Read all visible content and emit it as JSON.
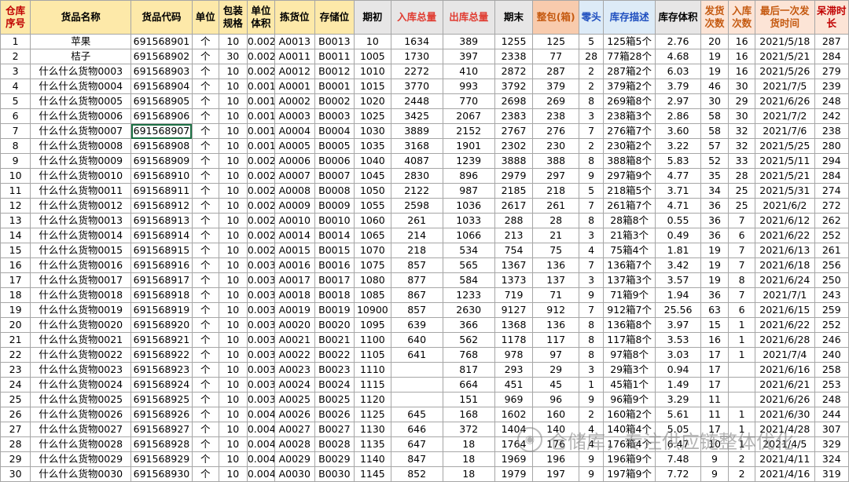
{
  "headers": {
    "seq": "仓库序号",
    "name": "货品名称",
    "code": "货品代码",
    "unit": "单位",
    "pack": "包装规格",
    "unitvol": "单位体积",
    "pick": "拣货位",
    "store": "存储位",
    "begin": "期初",
    "in": "入库总量",
    "out": "出库总量",
    "end": "期末",
    "whole": "整包(箱)",
    "loose": "零头",
    "desc": "库存描述",
    "vol": "库存体积",
    "dispatch": "发货次数",
    "inbound": "入库次数",
    "last": "最后一次发货时间",
    "idle": "呆滞时长"
  },
  "header_colors": {
    "yellow": "#fde9a9",
    "gray": "#e7e6e6",
    "pink": "#f8cbad",
    "blue": "#ddebf7",
    "tan": "#fce4d6"
  },
  "rows": [
    [
      "1",
      "苹果",
      "691568901",
      "个",
      "10",
      "0.002",
      "A0013",
      "B0013",
      "10",
      "1634",
      "389",
      "1255",
      "125",
      "5",
      "125箱5个",
      "2.76",
      "20",
      "16",
      "2021/5/18",
      "287"
    ],
    [
      "2",
      "桔子",
      "691568902",
      "个",
      "30",
      "0.002",
      "A0011",
      "B0011",
      "1005",
      "1730",
      "397",
      "2338",
      "77",
      "28",
      "77箱28个",
      "4.68",
      "19",
      "16",
      "2021/5/21",
      "284"
    ],
    [
      "3",
      "什么什么货物0003",
      "691568903",
      "个",
      "10",
      "0.002",
      "A0012",
      "B0012",
      "1010",
      "2272",
      "410",
      "2872",
      "287",
      "2",
      "287箱2个",
      "6.03",
      "19",
      "16",
      "2021/5/26",
      "279"
    ],
    [
      "4",
      "什么什么货物0004",
      "691568904",
      "个",
      "10",
      "0.001",
      "A0001",
      "B0001",
      "1015",
      "3770",
      "993",
      "3792",
      "379",
      "2",
      "379箱2个",
      "3.79",
      "46",
      "30",
      "2021/7/5",
      "239"
    ],
    [
      "5",
      "什么什么货物0005",
      "691568905",
      "个",
      "10",
      "0.001",
      "A0002",
      "B0002",
      "1020",
      "2448",
      "770",
      "2698",
      "269",
      "8",
      "269箱8个",
      "2.97",
      "30",
      "29",
      "2021/6/26",
      "248"
    ],
    [
      "6",
      "什么什么货物0006",
      "691568906",
      "个",
      "10",
      "0.001",
      "A0003",
      "B0003",
      "1025",
      "3425",
      "2067",
      "2383",
      "238",
      "3",
      "238箱3个",
      "2.86",
      "58",
      "30",
      "2021/7/2",
      "242"
    ],
    [
      "7",
      "什么什么货物0007",
      "691568907",
      "个",
      "10",
      "0.001",
      "A0004",
      "B0004",
      "1030",
      "3889",
      "2152",
      "2767",
      "276",
      "7",
      "276箱7个",
      "3.60",
      "58",
      "32",
      "2021/7/6",
      "238"
    ],
    [
      "8",
      "什么什么货物0008",
      "691568908",
      "个",
      "10",
      "0.001",
      "A0005",
      "B0005",
      "1035",
      "3168",
      "1901",
      "2302",
      "230",
      "2",
      "230箱2个",
      "3.22",
      "57",
      "32",
      "2021/5/25",
      "280"
    ],
    [
      "9",
      "什么什么货物0009",
      "691568909",
      "个",
      "10",
      "0.002",
      "A0006",
      "B0006",
      "1040",
      "4087",
      "1239",
      "3888",
      "388",
      "8",
      "388箱8个",
      "5.83",
      "52",
      "33",
      "2021/5/11",
      "294"
    ],
    [
      "10",
      "什么什么货物0010",
      "691568910",
      "个",
      "10",
      "0.002",
      "A0007",
      "B0007",
      "1045",
      "2830",
      "896",
      "2979",
      "297",
      "9",
      "297箱9个",
      "4.77",
      "35",
      "28",
      "2021/5/21",
      "284"
    ],
    [
      "11",
      "什么什么货物0011",
      "691568911",
      "个",
      "10",
      "0.002",
      "A0008",
      "B0008",
      "1050",
      "2122",
      "987",
      "2185",
      "218",
      "5",
      "218箱5个",
      "3.71",
      "34",
      "25",
      "2021/5/31",
      "274"
    ],
    [
      "12",
      "什么什么货物0012",
      "691568912",
      "个",
      "10",
      "0.002",
      "A0009",
      "B0009",
      "1055",
      "2598",
      "1036",
      "2617",
      "261",
      "7",
      "261箱7个",
      "4.71",
      "36",
      "25",
      "2021/6/2",
      "272"
    ],
    [
      "13",
      "什么什么货物0013",
      "691568913",
      "个",
      "10",
      "0.002",
      "A0010",
      "B0010",
      "1060",
      "261",
      "1033",
      "288",
      "28",
      "8",
      "28箱8个",
      "0.55",
      "36",
      "7",
      "2021/6/12",
      "262"
    ],
    [
      "14",
      "什么什么货物0014",
      "691568914",
      "个",
      "10",
      "0.002",
      "A0014",
      "B0014",
      "1065",
      "214",
      "1066",
      "213",
      "21",
      "3",
      "21箱3个",
      "0.49",
      "36",
      "6",
      "2021/6/22",
      "252"
    ],
    [
      "15",
      "什么什么货物0015",
      "691568915",
      "个",
      "10",
      "0.002",
      "A0015",
      "B0015",
      "1070",
      "218",
      "534",
      "754",
      "75",
      "4",
      "75箱4个",
      "1.81",
      "19",
      "7",
      "2021/6/13",
      "261"
    ],
    [
      "16",
      "什么什么货物0016",
      "691568916",
      "个",
      "10",
      "0.003",
      "A0016",
      "B0016",
      "1075",
      "857",
      "565",
      "1367",
      "136",
      "7",
      "136箱7个",
      "3.42",
      "19",
      "7",
      "2021/6/18",
      "256"
    ],
    [
      "17",
      "什么什么货物0017",
      "691568917",
      "个",
      "10",
      "0.003",
      "A0017",
      "B0017",
      "1080",
      "877",
      "584",
      "1373",
      "137",
      "3",
      "137箱3个",
      "3.57",
      "19",
      "8",
      "2021/6/24",
      "250"
    ],
    [
      "18",
      "什么什么货物0018",
      "691568918",
      "个",
      "10",
      "0.003",
      "A0018",
      "B0018",
      "1085",
      "867",
      "1233",
      "719",
      "71",
      "9",
      "71箱9个",
      "1.94",
      "36",
      "7",
      "2021/7/1",
      "243"
    ],
    [
      "19",
      "什么什么货物0019",
      "691568919",
      "个",
      "10",
      "0.003",
      "A0019",
      "B0019",
      "10900",
      "857",
      "2630",
      "9127",
      "912",
      "7",
      "912箱7个",
      "25.56",
      "63",
      "6",
      "2021/6/15",
      "259"
    ],
    [
      "20",
      "什么什么货物0020",
      "691568920",
      "个",
      "10",
      "0.003",
      "A0020",
      "B0020",
      "1095",
      "639",
      "366",
      "1368",
      "136",
      "8",
      "136箱8个",
      "3.97",
      "15",
      "1",
      "2021/6/22",
      "252"
    ],
    [
      "21",
      "什么什么货物0021",
      "691568921",
      "个",
      "10",
      "0.003",
      "A0021",
      "B0021",
      "1100",
      "640",
      "562",
      "1178",
      "117",
      "8",
      "117箱8个",
      "3.53",
      "16",
      "1",
      "2021/6/28",
      "246"
    ],
    [
      "22",
      "什么什么货物0022",
      "691568922",
      "个",
      "10",
      "0.003",
      "A0022",
      "B0022",
      "1105",
      "641",
      "768",
      "978",
      "97",
      "8",
      "97箱8个",
      "3.03",
      "17",
      "1",
      "2021/7/4",
      "240"
    ],
    [
      "23",
      "什么什么货物0023",
      "691568923",
      "个",
      "10",
      "0.003",
      "A0023",
      "B0023",
      "1110",
      "",
      "817",
      "293",
      "29",
      "3",
      "29箱3个",
      "0.94",
      "17",
      "",
      "2021/6/16",
      "258"
    ],
    [
      "24",
      "什么什么货物0024",
      "691568924",
      "个",
      "10",
      "0.003",
      "A0024",
      "B0024",
      "1115",
      "",
      "664",
      "451",
      "45",
      "1",
      "45箱1个",
      "1.49",
      "17",
      "",
      "2021/6/21",
      "253"
    ],
    [
      "25",
      "什么什么货物0025",
      "691568925",
      "个",
      "10",
      "0.003",
      "A0025",
      "B0025",
      "1120",
      "",
      "151",
      "969",
      "96",
      "9",
      "96箱9个",
      "3.29",
      "11",
      "",
      "2021/6/26",
      "248"
    ],
    [
      "26",
      "什么什么货物0026",
      "691568926",
      "个",
      "10",
      "0.004",
      "A0026",
      "B0026",
      "1125",
      "645",
      "168",
      "1602",
      "160",
      "2",
      "160箱2个",
      "5.61",
      "11",
      "1",
      "2021/6/30",
      "244"
    ],
    [
      "27",
      "什么什么货物0027",
      "691568927",
      "个",
      "10",
      "0.004",
      "A0027",
      "B0027",
      "1130",
      "646",
      "372",
      "1404",
      "140",
      "4",
      "140箱4个",
      "5.05",
      "17",
      "1",
      "2021/4/28",
      "307"
    ],
    [
      "28",
      "什么什么货物0028",
      "691568928",
      "个",
      "10",
      "0.004",
      "A0028",
      "B0028",
      "1135",
      "647",
      "18",
      "1764",
      "176",
      "4",
      "176箱4个",
      "6.47",
      "10",
      "1",
      "2021/4/5",
      "329"
    ],
    [
      "29",
      "什么什么货物0029",
      "691568929",
      "个",
      "10",
      "0.004",
      "A0029",
      "B0029",
      "1140",
      "847",
      "18",
      "1969",
      "196",
      "9",
      "196箱9个",
      "7.48",
      "9",
      "2",
      "2021/4/11",
      "324"
    ],
    [
      "30",
      "什么什么货物0030",
      "691568930",
      "个",
      "10",
      "0.004",
      "A0030",
      "B0030",
      "1145",
      "852",
      "18",
      "1979",
      "197",
      "9",
      "197箱9个",
      "7.72",
      "9",
      "2",
      "2021/4/16",
      "319"
    ]
  ],
  "watermark": {
    "text": "仓储库，专注供应链整体优化",
    "icon": "wechat-icon"
  }
}
